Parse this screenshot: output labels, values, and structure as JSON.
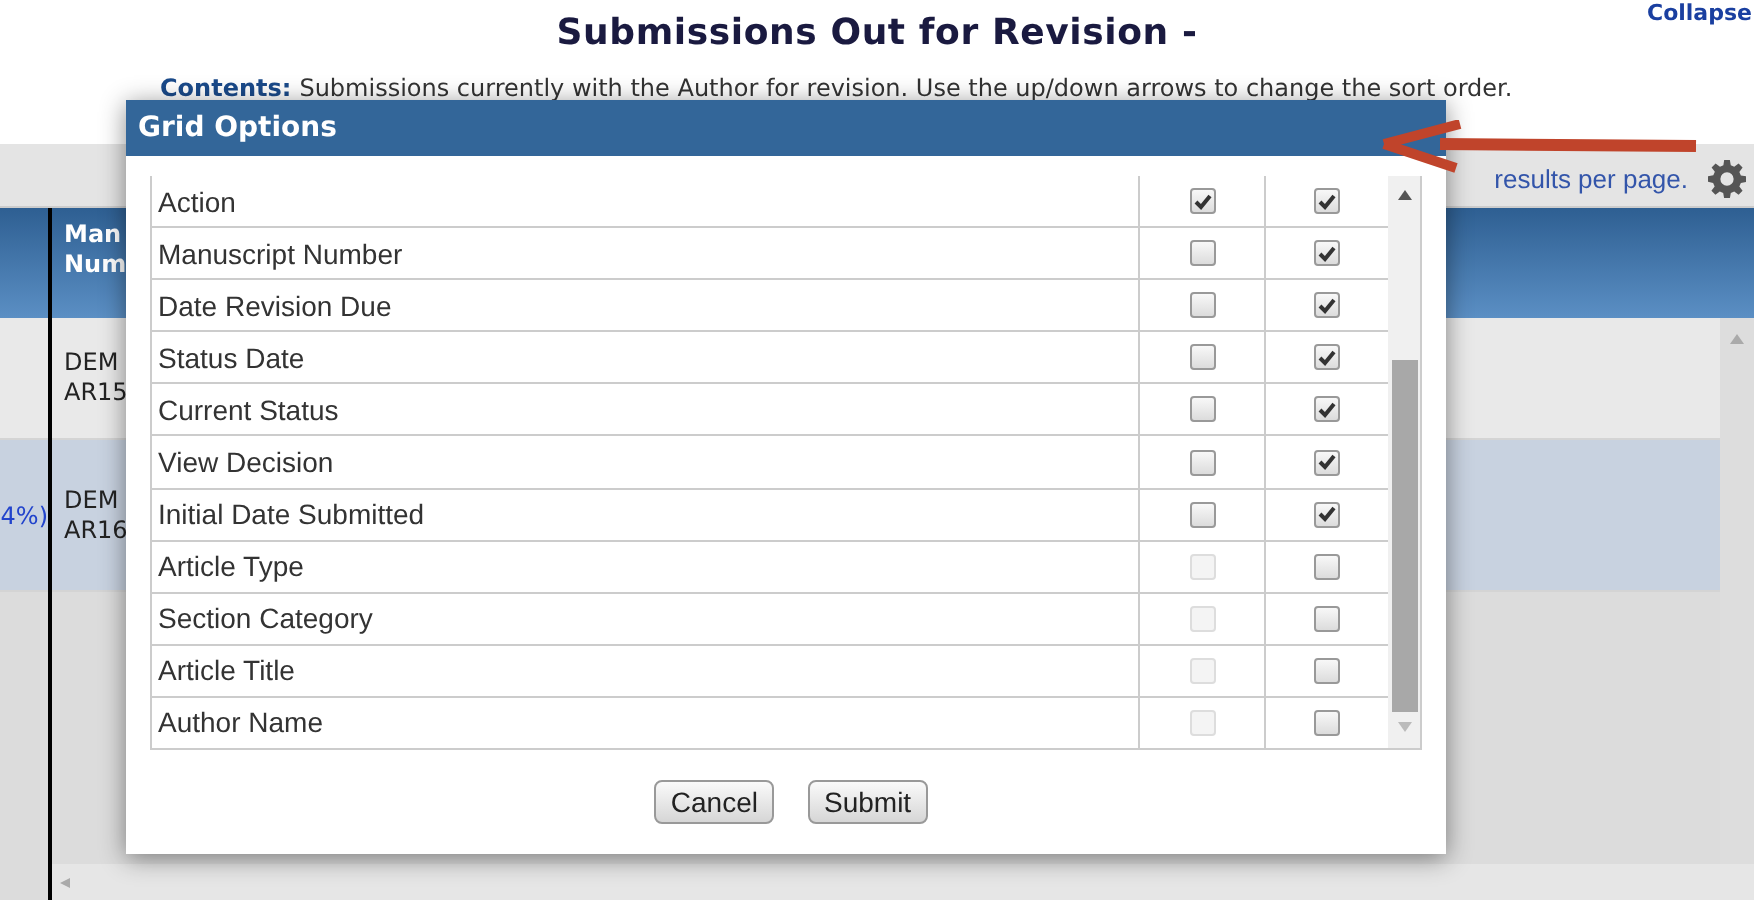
{
  "page": {
    "title": "Submissions Out for Revision -",
    "collapse_link": "Collapse",
    "contents_label": "Contents:",
    "contents_text": "Submissions currently with the Author for revision. Use the up/down arrows to change the sort order.",
    "results_link": "results per page."
  },
  "grid": {
    "header": [
      "Man",
      "Num"
    ],
    "rows": [
      {
        "left": "",
        "lines": [
          "DEM",
          "AR15"
        ],
        "selected": false
      },
      {
        "left": "4%)",
        "lines": [
          "DEM",
          "AR16"
        ],
        "selected": true
      }
    ]
  },
  "dialog": {
    "title": "Grid Options",
    "options": [
      {
        "label": "Action",
        "column_2_checked": true,
        "column_2_disabled": false,
        "column_3_checked": true
      },
      {
        "label": "Manuscript Number",
        "column_2_checked": false,
        "column_2_disabled": false,
        "column_3_checked": true
      },
      {
        "label": "Date Revision Due",
        "column_2_checked": false,
        "column_2_disabled": false,
        "column_3_checked": true
      },
      {
        "label": "Status Date",
        "column_2_checked": false,
        "column_2_disabled": false,
        "column_3_checked": true
      },
      {
        "label": "Current Status",
        "column_2_checked": false,
        "column_2_disabled": false,
        "column_3_checked": true
      },
      {
        "label": "View Decision",
        "column_2_checked": false,
        "column_2_disabled": false,
        "column_3_checked": true
      },
      {
        "label": "Initial Date Submitted",
        "column_2_checked": false,
        "column_2_disabled": false,
        "column_3_checked": true
      },
      {
        "label": "Article Type",
        "column_2_checked": false,
        "column_2_disabled": true,
        "column_3_checked": false
      },
      {
        "label": "Section Category",
        "column_2_checked": false,
        "column_2_disabled": true,
        "column_3_checked": false
      },
      {
        "label": "Article Title",
        "column_2_checked": false,
        "column_2_disabled": true,
        "column_3_checked": false
      },
      {
        "label": "Author Name",
        "column_2_checked": false,
        "column_2_disabled": true,
        "column_3_checked": false
      }
    ],
    "buttons": [
      "Cancel",
      "Submit"
    ]
  }
}
